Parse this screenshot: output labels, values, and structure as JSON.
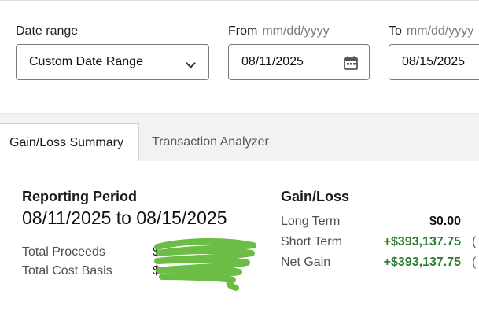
{
  "filters": {
    "date_range_label": "Date range",
    "date_range_value": "Custom Date Range",
    "from_label": "From",
    "from_hint": "mm/dd/yyyy",
    "from_value": "08/11/2025",
    "to_label": "To",
    "to_hint": "mm/dd/yyyy",
    "to_value": "08/15/2025"
  },
  "tabs": [
    {
      "label": "Gain/Loss Summary",
      "active": true
    },
    {
      "label": "Transaction Analyzer",
      "active": false
    }
  ],
  "reporting": {
    "title": "Reporting Period",
    "range": "08/11/2025 to 08/15/2025",
    "rows": [
      {
        "label": "Total Proceeds",
        "currency": "$"
      },
      {
        "label": "Total Cost Basis",
        "currency": "$"
      }
    ]
  },
  "gainloss": {
    "title": "Gain/Loss",
    "rows": [
      {
        "label": "Long Term",
        "value": "$0.00"
      },
      {
        "label": "Short Term",
        "value": "+$393,137.75",
        "extra": "("
      },
      {
        "label": "Net Gain",
        "value": "+$393,137.75",
        "extra": "("
      }
    ]
  },
  "colors": {
    "positive": "#2e7d32",
    "redaction_scribble": "#6cbd45"
  },
  "icons": {
    "date_range_dropdown": "chevron-down-icon",
    "from_calendar": "calendar-icon"
  }
}
